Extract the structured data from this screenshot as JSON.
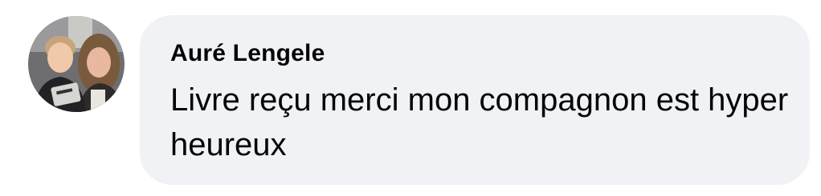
{
  "comment": {
    "author": "Auré Lengele",
    "text": "Livre reçu merci mon compagnon est hyper heureux",
    "avatar_icon": "profile-photo",
    "bubble_color": "#f0f2f5",
    "text_color": "#050505"
  }
}
